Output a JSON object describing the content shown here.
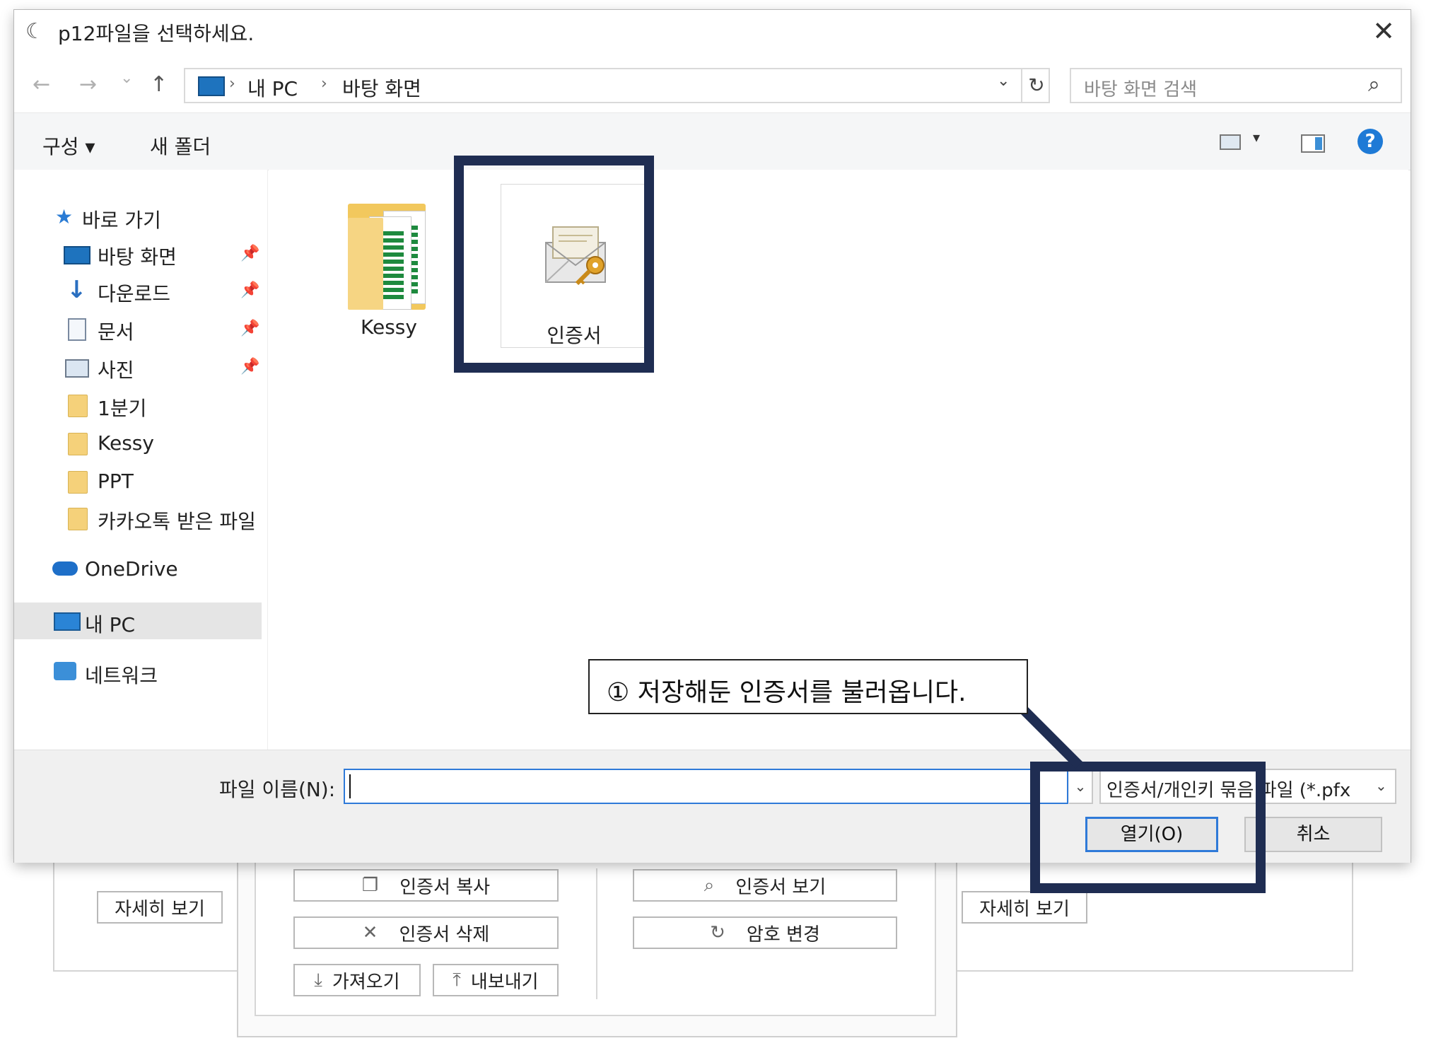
{
  "dialog": {
    "title": "p12파일을 선택하세요.",
    "close_glyph": "✕"
  },
  "nav": {
    "back_glyph": "←",
    "forward_glyph": "→",
    "recent_glyph": "⌄",
    "up_glyph": "↑",
    "breadcrumb": [
      "내 PC",
      "바탕 화면"
    ],
    "breadcrumb_sep": "›",
    "dropdown_glyph": "⌄",
    "refresh_glyph": "↻",
    "search_placeholder": "바탕 화면 검색",
    "search_glyph": "⌕"
  },
  "toolbar": {
    "organize_label": "구성 ▾",
    "new_folder_label": "새 폴더",
    "view_caret": "▾",
    "help_glyph": "?"
  },
  "sidebar": {
    "quick_access": "바로 가기",
    "items": [
      {
        "label": "바탕 화면",
        "pinned": true,
        "icon": "desktop-icon"
      },
      {
        "label": "다운로드",
        "pinned": true,
        "icon": "download-icon"
      },
      {
        "label": "문서",
        "pinned": true,
        "icon": "document-icon"
      },
      {
        "label": "사진",
        "pinned": true,
        "icon": "pictures-icon"
      },
      {
        "label": "1분기",
        "pinned": false,
        "icon": "folder-icon"
      },
      {
        "label": "Kessy",
        "pinned": false,
        "icon": "folder-icon"
      },
      {
        "label": "PPT",
        "pinned": false,
        "icon": "folder-icon"
      },
      {
        "label": "카카오톡 받은 파일",
        "pinned": false,
        "icon": "folder-icon"
      }
    ],
    "onedrive": "OneDrive",
    "mypc": "내 PC",
    "network": "네트워크",
    "pin_glyph": "📌"
  },
  "files": [
    {
      "name": "Kessy",
      "type": "folder"
    },
    {
      "name": "인증서",
      "type": "certificate",
      "selected": true
    }
  ],
  "callout": {
    "text": "① 저장해둔 인증서를 불러옵니다."
  },
  "bottom": {
    "filename_label": "파일 이름(N):",
    "filename_value": "",
    "filter_text": "인증서/개인키 묶음 파일 (*.pfx",
    "dropdown_glyph": "⌄",
    "open_label": "열기(O)",
    "cancel_label": "취소"
  },
  "background_app": {
    "detail_left": "자세히 보기",
    "detail_right": "자세히 보기",
    "copy_cert": "인증서 복사",
    "delete_cert": "인증서 삭제",
    "import": "가져오기",
    "export": "내보내기",
    "view_cert": "인증서 보기",
    "change_pw": "암호 변경"
  },
  "colors": {
    "highlight": "#1f2d52",
    "accent": "#2f7ad8",
    "help": "#1e7ad6"
  }
}
